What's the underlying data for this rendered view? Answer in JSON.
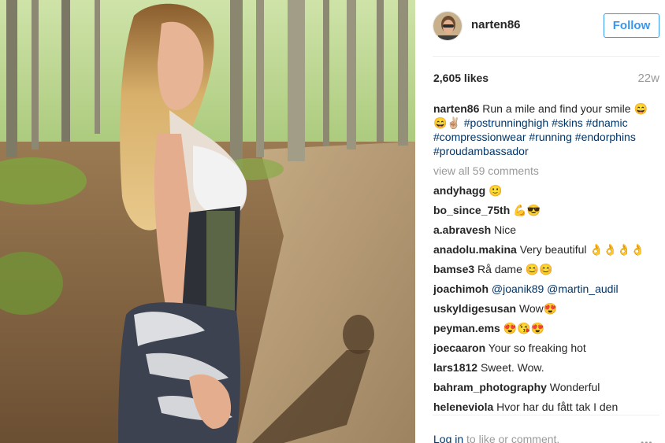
{
  "post": {
    "username": "narten86",
    "follow_label": "Follow",
    "likes": "2,605 likes",
    "time": "22w",
    "caption": {
      "username": "narten86",
      "text": "Run a mile and find your smile 😄😄✌🏼",
      "hashtags": [
        "#postrunninghigh",
        "#skins",
        "#dnamic",
        "#compressionwear",
        "#running",
        "#endorphins",
        "#proudambassador"
      ]
    },
    "view_all": "view all 59 comments",
    "comments": [
      {
        "user": "andyhagg",
        "text": "🙂"
      },
      {
        "user": "bo_since_75th",
        "text": "💪😎"
      },
      {
        "user": "a.abravesh",
        "text": "Nice"
      },
      {
        "user": "anadolu.makina",
        "text": "Very beautiful 👌👌👌👌"
      },
      {
        "user": "bamse3",
        "text": "Rå dame 😊😊"
      },
      {
        "user": "joachimoh",
        "mentions": [
          "@joanik89",
          "@martin_audil"
        ]
      },
      {
        "user": "uskyldigesusan",
        "text": "Wow😍"
      },
      {
        "user": "peyman.ems",
        "text": "😍😘😍"
      },
      {
        "user": "joecaaron",
        "text": "Your so freaking hot"
      },
      {
        "user": "lars1812",
        "text": "Sweet. Wow."
      },
      {
        "user": "bahram_photography",
        "text": "Wonderful"
      },
      {
        "user": "heleneviola",
        "text": "Hvor har du fått tak I den"
      }
    ],
    "login_link": "Log in",
    "login_text": "to like or comment.",
    "more_icon": "more-options-icon",
    "more_glyph": "•••"
  },
  "colors": {
    "link": "#003569",
    "follow": "#3897f0",
    "muted": "#999999"
  }
}
